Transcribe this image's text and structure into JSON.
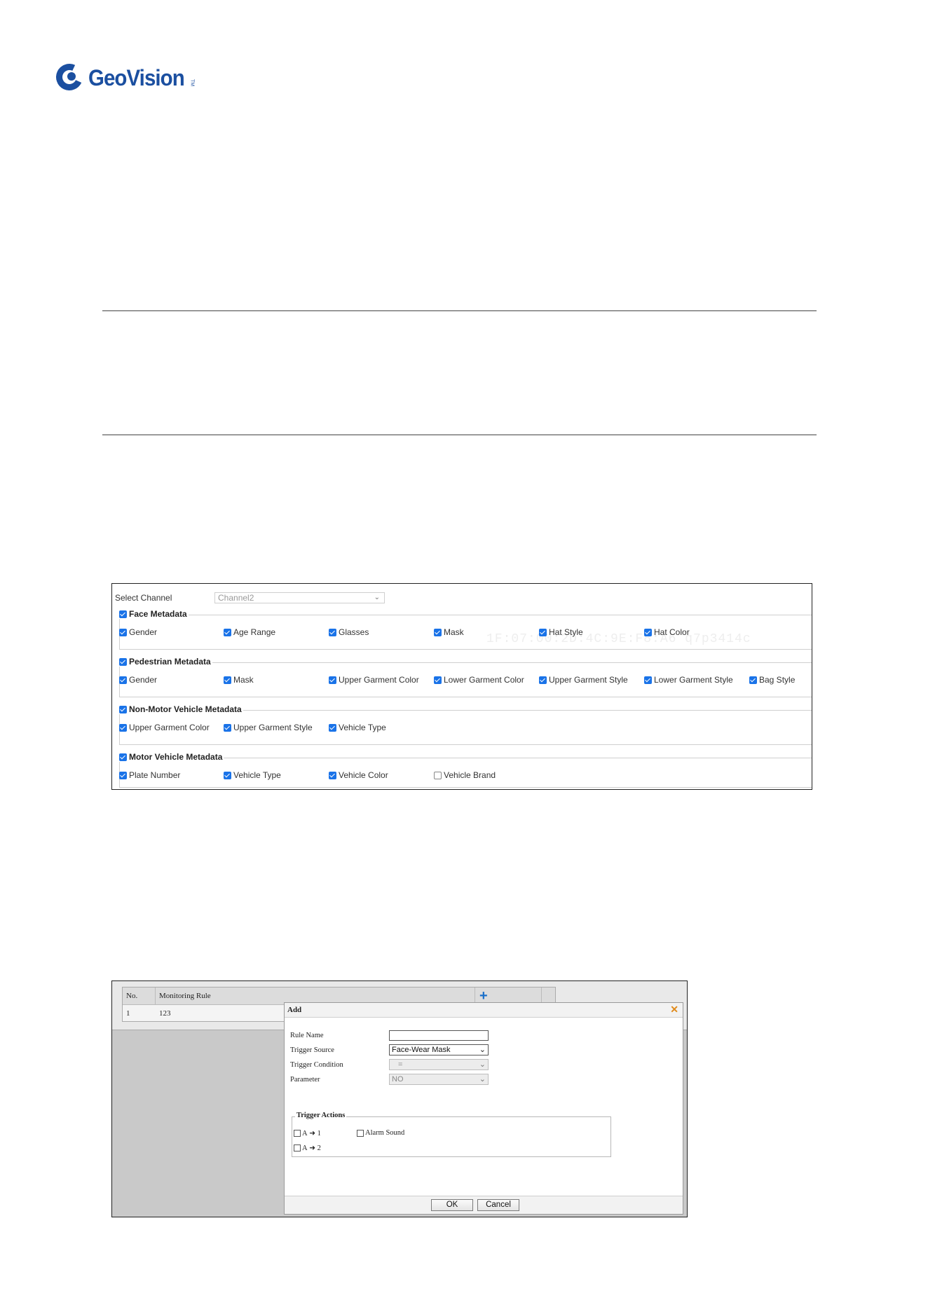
{
  "brand": {
    "name": "GeoVision",
    "mark": "TM",
    "color": "#1b4fa0"
  },
  "metadata_panel": {
    "select_channel_label": "Select Channel",
    "select_channel_value": "Channel2",
    "watermark": "1F:07:00:2D:4C:9E:F8:A6  q7p3414c",
    "groups": [
      {
        "title": "Face Metadata",
        "checked": true,
        "options": [
          {
            "label": "Gender",
            "checked": true
          },
          {
            "label": "Age Range",
            "checked": true
          },
          {
            "label": "Glasses",
            "checked": true
          },
          {
            "label": "Mask",
            "checked": true
          },
          {
            "label": "Hat Style",
            "checked": true
          },
          {
            "label": "Hat Color",
            "checked": true
          }
        ]
      },
      {
        "title": "Pedestrian Metadata",
        "checked": true,
        "options": [
          {
            "label": "Gender",
            "checked": true
          },
          {
            "label": "Mask",
            "checked": true
          },
          {
            "label": "Upper Garment Color",
            "checked": true
          },
          {
            "label": "Lower Garment Color",
            "checked": true
          },
          {
            "label": "Upper Garment Style",
            "checked": true
          },
          {
            "label": "Lower Garment Style",
            "checked": true
          },
          {
            "label": "Bag Style",
            "checked": true
          }
        ]
      },
      {
        "title": "Non-Motor Vehicle Metadata",
        "checked": true,
        "options": [
          {
            "label": "Upper Garment Color",
            "checked": true
          },
          {
            "label": "Upper Garment Style",
            "checked": true
          },
          {
            "label": "Vehicle Type",
            "checked": true
          }
        ]
      },
      {
        "title": "Motor Vehicle Metadata",
        "checked": true,
        "options": [
          {
            "label": "Plate Number",
            "checked": true
          },
          {
            "label": "Vehicle Type",
            "checked": true
          },
          {
            "label": "Vehicle Color",
            "checked": true
          },
          {
            "label": "Vehicle Brand",
            "checked": false
          }
        ]
      }
    ]
  },
  "rule_panel": {
    "table": {
      "headers": {
        "no": "No.",
        "rule": "Monitoring Rule",
        "add_icon": "plus-icon"
      },
      "rows": [
        {
          "no": "1",
          "rule": "123"
        }
      ]
    },
    "dialog": {
      "title": "Add",
      "close_icon": "close-icon",
      "fields": {
        "rule_name_label": "Rule Name",
        "rule_name_value": "",
        "trigger_source_label": "Trigger Source",
        "trigger_source_value": "Face-Wear Mask",
        "trigger_condition_label": "Trigger Condition",
        "trigger_condition_value": "=",
        "parameter_label": "Parameter",
        "parameter_value": "NO"
      },
      "trigger_actions": {
        "title": "Trigger Actions",
        "items": [
          {
            "label_a": "A",
            "label_b": "1",
            "checked": false
          },
          {
            "label": "Alarm Sound",
            "checked": false
          },
          {
            "label_a": "A",
            "label_b": "2",
            "checked": false
          }
        ]
      },
      "buttons": {
        "ok": "OK",
        "cancel": "Cancel"
      }
    }
  }
}
